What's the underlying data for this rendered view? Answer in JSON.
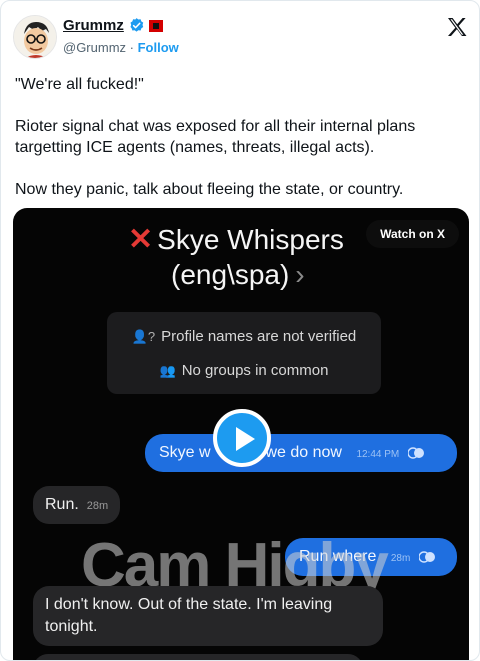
{
  "author": {
    "display_name": "Grummz",
    "handle": "@Grummz",
    "separator": " · ",
    "follow_label": "Follow"
  },
  "tweet": {
    "line1": "\"We're all fucked!\"",
    "line2": "Rioter signal chat was exposed for all their internal plans targetting ICE agents (names, threats, illegal acts).",
    "line3": "Now they panic, talk about fleeing the state, or country."
  },
  "video": {
    "watch_label": "Watch on X",
    "chat_title": "Skye Whispers",
    "chat_subtitle": "(eng\\spa)",
    "chevron": "›",
    "info_line1": "Profile names are not verified",
    "info_line2": "No groups in common",
    "messages": {
      "out1_text": "Skye w",
      "out1_text_b": "we do now",
      "out1_time": "12:44 PM",
      "in1_text": "Run.",
      "in1_time": "28m",
      "out2_text": "Run where",
      "out2_time": "28m",
      "in2_text": "I don't know. Out of the state. I'm leaving tonight."
    },
    "watermark": "Cam Higby"
  },
  "colors": {
    "accent": "#1d9bf0",
    "bubble_outgoing": "#1f6fe0",
    "bubble_incoming": "#262628",
    "flag_red": "#d40000"
  },
  "icons": [
    "avatar-cartoon",
    "verified-badge-icon",
    "flag-icon",
    "x-logo-icon",
    "red-x-icon",
    "chevron-right-icon",
    "profile-question-icon",
    "groups-icon",
    "read-check-icon",
    "play-icon"
  ]
}
